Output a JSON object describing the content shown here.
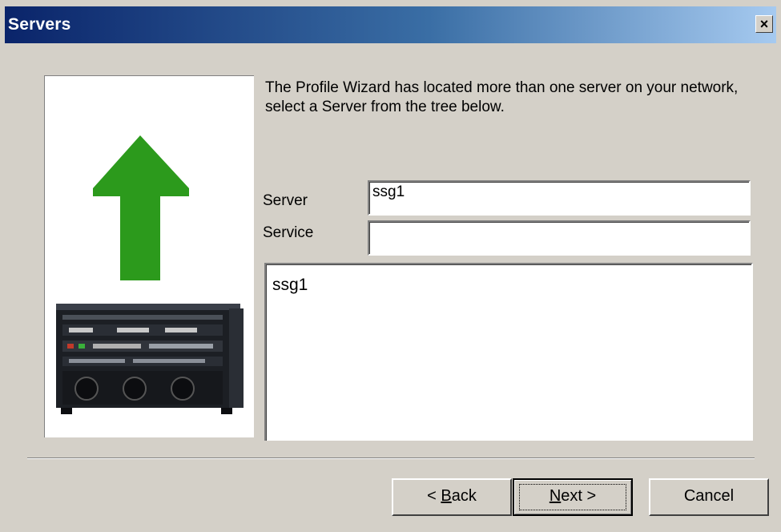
{
  "window": {
    "title": "Servers",
    "close_glyph": "×"
  },
  "instructions": "The Profile Wizard has located more than one server on your network, select a Server from the tree below.",
  "form": {
    "server_label": "Server",
    "server_value": "ssg1",
    "service_label": "Service",
    "service_value": ""
  },
  "tree": {
    "items": [
      "ssg1"
    ]
  },
  "buttons": {
    "back": {
      "prefix": "< ",
      "mnemonic": "B",
      "rest": "ack"
    },
    "next": {
      "mnemonic": "N",
      "rest": "ext >"
    },
    "cancel": "Cancel"
  },
  "colors": {
    "arrow": "#2c9a1c",
    "title_gradient_start": "#0a246a",
    "title_gradient_end": "#a6caf0",
    "dialog_face": "#d4d0c8"
  },
  "icons": {
    "arrow": "up-arrow-icon",
    "hardware": "server-chassis-image"
  }
}
